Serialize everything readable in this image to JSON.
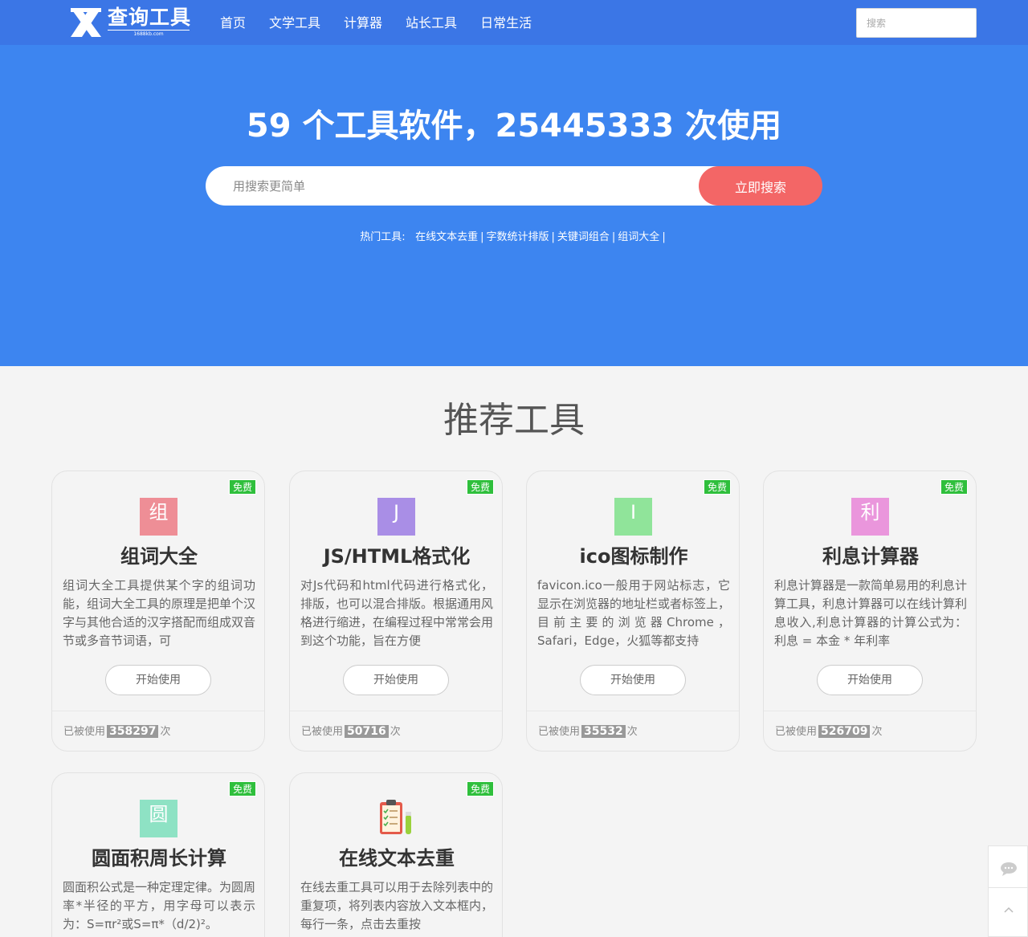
{
  "header": {
    "logo_text": "查询工具",
    "logo_sub": "1688kb.com",
    "nav": [
      "首页",
      "文学工具",
      "计算器",
      "站长工具",
      "日常生活"
    ],
    "search_placeholder": "搜索"
  },
  "hero": {
    "title": "59 个工具软件，25445333 次使用",
    "search_placeholder": "用搜索更简单",
    "search_button": "立即搜索",
    "hot_label": "热门工具:",
    "hot_links": [
      "在线文本去重",
      "字数统计排版",
      "关键词组合",
      "组词大全"
    ],
    "hot_sep": "|"
  },
  "section": {
    "title": "推荐工具"
  },
  "card_common": {
    "badge": "免费",
    "start_label": "开始使用",
    "used_prefix": "已被使用",
    "used_suffix": "次"
  },
  "cards": [
    {
      "icon_letter": "组",
      "icon_color": "#ee8e96",
      "title": "组词大全",
      "desc": "组词大全工具提供某个字的组词功能，组词大全工具的原理是把单个汉字与其他合适的汉字搭配而组成双音节或多音节词语，可",
      "count": "358297"
    },
    {
      "icon_letter": "J",
      "icon_color": "#a98ee6",
      "title": "JS/HTML格式化",
      "desc": "对Js代码和html代码进行格式化，排版，也可以混合排版。根据通用风格进行缩进，在编程过程中常常会用到这个功能，旨在方便",
      "count": "50716"
    },
    {
      "icon_letter": "I",
      "icon_color": "#90e49a",
      "title": "ico图标制作",
      "desc": "favicon.ico一般用于网站标志，它显示在浏览器的地址栏或者标签上，目前主要的浏览器Chrome，Safari，Edge，火狐等都支持",
      "count": "35532"
    },
    {
      "icon_letter": "利",
      "icon_color": "#ea96dc",
      "title": "利息计算器",
      "desc": "利息计算器是一款简单易用的利息计算工具，利息计算器可以在线计算利息收入,利息计算器的计算公式为：利息 = 本金 * 年利率",
      "count": "526709"
    },
    {
      "icon_letter": "圆",
      "icon_color": "#8ee2c4",
      "title": "圆面积周长计算",
      "desc": "圆面积公式是一种定理定律。为圆周率*半径的平方，用字母可以表示为：S=πr²或S=π*（d/2)²。",
      "count": ""
    },
    {
      "icon_letter": "",
      "icon_color": "",
      "title": "在线文本去重",
      "desc": "在线去重工具可以用于去除列表中的重复项，将列表内容放入文本框内，每行一条，点击去重按",
      "count": ""
    }
  ]
}
